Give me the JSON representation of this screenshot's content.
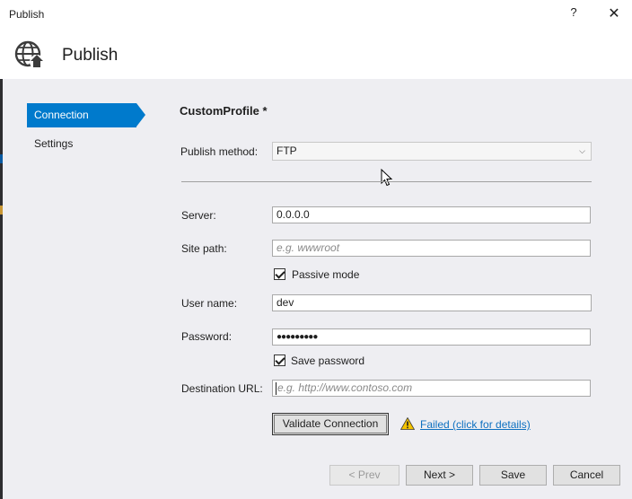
{
  "window": {
    "title": "Publish",
    "help_glyph": "?",
    "close_glyph": "✕"
  },
  "header": {
    "title": "Publish"
  },
  "nav": {
    "connection": "Connection",
    "settings": "Settings"
  },
  "profile": {
    "name": "CustomProfile *"
  },
  "form": {
    "publish_method_label": "Publish method:",
    "publish_method_value": "FTP",
    "server_label": "Server:",
    "server_value": "0.0.0.0",
    "site_path_label": "Site path:",
    "site_path_placeholder": "e.g. wwwroot",
    "passive_mode_label": "Passive mode",
    "passive_mode_checked": true,
    "user_name_label": "User name:",
    "user_name_value": "dev",
    "password_label": "Password:",
    "password_value": "●●●●●●●●●",
    "save_password_label": "Save password",
    "save_password_checked": true,
    "destination_url_label": "Destination URL:",
    "destination_url_placeholder": "e.g. http://www.contoso.com"
  },
  "validate": {
    "button_label": "Validate Connection",
    "status_text": "Failed (click for details)"
  },
  "footer": {
    "prev_label": "< Prev",
    "next_label": "Next >",
    "save_label": "Save",
    "cancel_label": "Cancel"
  },
  "colors": {
    "accent": "#007acc",
    "link": "#0e70c0",
    "warning": "#f5c400",
    "panel_bg": "#eeeef2"
  }
}
